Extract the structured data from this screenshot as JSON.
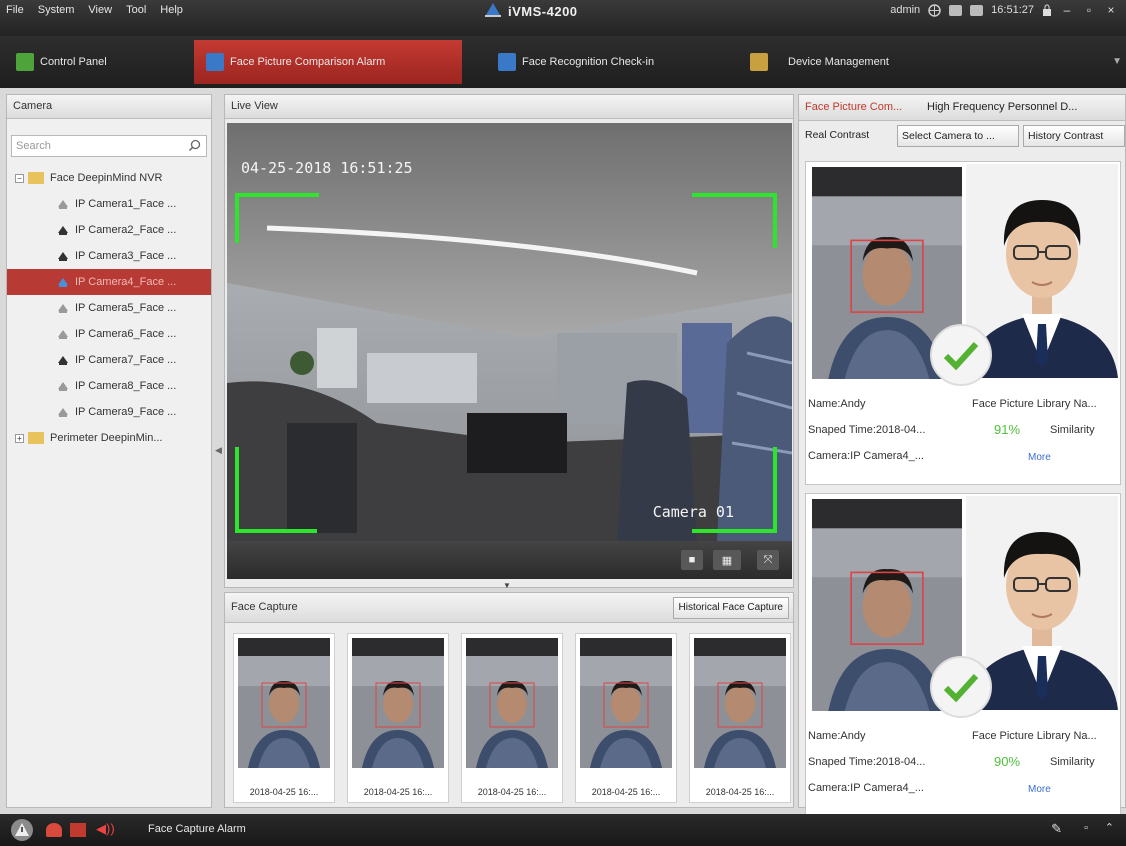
{
  "menu": [
    "File",
    "System",
    "View",
    "Tool",
    "Help"
  ],
  "app_title": "iVMS-4200",
  "status": {
    "user": "admin",
    "time": "16:51:27"
  },
  "tabs": [
    {
      "label": "Control Panel",
      "color": "#4fa33b"
    },
    {
      "label": "Face Picture Comparison Alarm",
      "color": "#3a78c8",
      "active": true
    },
    {
      "label": "Face Recognition Check-in",
      "color": "#3a78c8"
    },
    {
      "label": "Device Management",
      "color": "#c8a040"
    }
  ],
  "camera_panel": {
    "title": "Camera",
    "search_placeholder": "Search",
    "tree": [
      {
        "label": "Face DeepinMind NVR",
        "type": "group",
        "expander": "−"
      },
      {
        "label": "IP Camera1_Face ...",
        "type": "cam-off"
      },
      {
        "label": "IP Camera2_Face ...",
        "type": "cam-on"
      },
      {
        "label": "IP Camera3_Face ...",
        "type": "cam-on"
      },
      {
        "label": "IP Camera4_Face ...",
        "type": "cam-live",
        "selected": true
      },
      {
        "label": "IP Camera5_Face ...",
        "type": "cam-off"
      },
      {
        "label": "IP Camera6_Face ...",
        "type": "cam-off"
      },
      {
        "label": "IP Camera7_Face ...",
        "type": "cam-on"
      },
      {
        "label": "IP Camera8_Face ...",
        "type": "cam-off"
      },
      {
        "label": "IP Camera9_Face ...",
        "type": "cam-off"
      },
      {
        "label": "Perimeter DeepinMin...",
        "type": "group",
        "expander": "+"
      }
    ]
  },
  "live_view": {
    "title": "Live View",
    "osd_time": "04-25-2018 16:51:25",
    "osd_camera": "Camera 01"
  },
  "face_capture": {
    "title": "Face Capture",
    "history_button": "Historical Face Capture",
    "captures": [
      "2018-04-25 16:...",
      "2018-04-25 16:...",
      "2018-04-25 16:...",
      "2018-04-25 16:...",
      "2018-04-25 16:..."
    ]
  },
  "right_panel": {
    "tabs": [
      "Face Picture Com...",
      "High Frequency Personnel D..."
    ],
    "subtabs": [
      "Real Contrast",
      "Select Camera to ...",
      "History Contrast"
    ],
    "cards": [
      {
        "name": "Name:Andy",
        "library": "Face Picture Library Na...",
        "snaped": "Snaped Time:2018-04...",
        "similarity_pct": "91%",
        "similarity_label": "Similarity",
        "camera": "Camera:IP Camera4_...",
        "more": "More"
      },
      {
        "name": "Name:Andy",
        "library": "Face Picture Library Na...",
        "snaped": "Snaped Time:2018-04...",
        "similarity_pct": "90%",
        "similarity_label": "Similarity",
        "camera": "Camera:IP Camera4_...",
        "more": "More"
      }
    ]
  },
  "bottom_bar": {
    "alarm_label": "Face Capture Alarm"
  }
}
